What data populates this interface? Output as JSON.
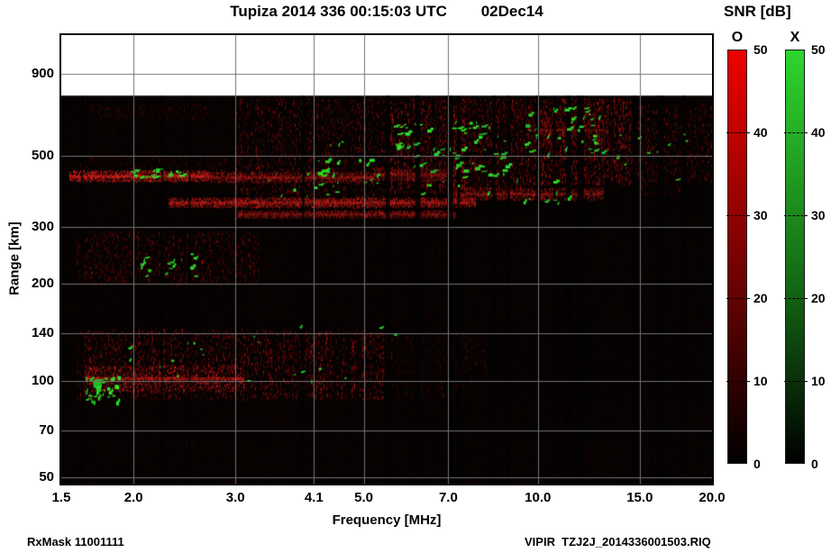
{
  "figure": {
    "footer_left": "RxMask 11001111",
    "footer_right": "VIPIR  TZJ2J_2014336001503.RIQ"
  },
  "chart_data": {
    "type": "heatmap",
    "title": "Tupiza 2014 336 00:15:03 UTC        02Dec14",
    "xlabel": "Frequency [MHz]",
    "ylabel": "Range [km]",
    "x_scale": "log",
    "y_scale": "log",
    "x_range": [
      1.5,
      20.0
    ],
    "y_range": [
      47.8,
      1188
    ],
    "x_ticks": [
      1.5,
      2.0,
      3.0,
      4.1,
      5.0,
      7.0,
      10.0,
      15.0,
      20.0
    ],
    "y_ticks": [
      900,
      500,
      300,
      200,
      140,
      100,
      70,
      50
    ],
    "grid": true,
    "data_top_km": 770,
    "background_color": "#060202",
    "o_mode_color": "#cc1414",
    "x_mode_color": "#2ec42e",
    "grid_color": "#737373",
    "seed": 11,
    "colorbar": {
      "title": "SNR [dB]",
      "min": 0,
      "max": 50,
      "ticks": [
        0,
        10,
        20,
        30,
        40,
        50
      ],
      "bars": [
        {
          "label": "O",
          "top_color": "#ee0000",
          "mid_color": "#6f0202"
        },
        {
          "label": "X",
          "top_color": "#2ed52e",
          "mid_color": "#156c15"
        }
      ]
    },
    "noise_bands": [
      {
        "f0": 1.55,
        "f1": 3.2,
        "r0": 340,
        "r1": 760,
        "density": 0.05,
        "alpha": 0.14
      },
      {
        "f0": 1.68,
        "f1": 2.68,
        "r0": 655,
        "r1": 730,
        "density": 0.22,
        "alpha": 0.26
      },
      {
        "f0": 1.61,
        "f1": 2.9,
        "r0": 430,
        "r1": 505,
        "density": 0.2,
        "alpha": 0.3
      },
      {
        "f0": 3.0,
        "f1": 5.5,
        "r0": 345,
        "r1": 760,
        "density": 0.32,
        "alpha": 0.45
      },
      {
        "f0": 5.5,
        "f1": 9.4,
        "r0": 385,
        "r1": 760,
        "density": 0.5,
        "alpha": 0.58
      },
      {
        "f0": 9.4,
        "f1": 14.5,
        "r0": 410,
        "r1": 760,
        "density": 0.52,
        "alpha": 0.62
      },
      {
        "f0": 14.5,
        "f1": 20.0,
        "r0": 420,
        "r1": 730,
        "density": 0.3,
        "alpha": 0.45
      },
      {
        "f0": 14.5,
        "f1": 18.0,
        "r0": 380,
        "r1": 425,
        "density": 0.18,
        "alpha": 0.3
      },
      {
        "f0": 3.2,
        "f1": 20.0,
        "r0": 150,
        "r1": 335,
        "density": 0.05,
        "alpha": 0.11
      },
      {
        "f0": 1.6,
        "f1": 3.3,
        "r0": 200,
        "r1": 292,
        "density": 0.3,
        "alpha": 0.42
      },
      {
        "f0": 1.6,
        "f1": 5.5,
        "r0": 88,
        "r1": 145,
        "density": 0.42,
        "alpha": 0.5
      },
      {
        "f0": 5.5,
        "f1": 8.2,
        "r0": 90,
        "r1": 140,
        "density": 0.16,
        "alpha": 0.28
      },
      {
        "f0": 1.5,
        "f1": 20.0,
        "r0": 48,
        "r1": 86,
        "density": 0.05,
        "alpha": 0.13
      }
    ],
    "traces": [
      {
        "f0": 1.55,
        "f1": 2.7,
        "r0": 418,
        "r1": 452,
        "alpha": 0.95
      },
      {
        "f0": 2.7,
        "f1": 5.2,
        "r0": 415,
        "r1": 448,
        "alpha": 0.5
      },
      {
        "f0": 5.2,
        "f1": 7.2,
        "r0": 420,
        "r1": 462,
        "alpha": 0.45
      },
      {
        "f0": 2.3,
        "f1": 7.8,
        "r0": 348,
        "r1": 372,
        "alpha": 0.7
      },
      {
        "f0": 3.0,
        "f1": 7.2,
        "r0": 322,
        "r1": 340,
        "alpha": 0.42
      },
      {
        "f0": 7.0,
        "f1": 13.0,
        "r0": 365,
        "r1": 400,
        "alpha": 0.55
      },
      {
        "f0": 9.6,
        "f1": 13.2,
        "r0": 530,
        "r1": 690,
        "alpha": 0.4
      },
      {
        "f0": 1.65,
        "f1": 3.1,
        "r0": 93,
        "r1": 112,
        "alpha": 0.8
      }
    ],
    "green_clusters": [
      {
        "f0": 1.95,
        "f1": 2.4,
        "r0": 430,
        "r1": 458,
        "n": 22,
        "w": 6,
        "h": 2
      },
      {
        "f0": 2.05,
        "f1": 2.6,
        "r0": 208,
        "r1": 250,
        "n": 18,
        "w": 4,
        "h": 3
      },
      {
        "f0": 3.4,
        "f1": 5.3,
        "r0": 375,
        "r1": 490,
        "n": 28,
        "w": 5,
        "h": 3
      },
      {
        "f0": 5.6,
        "f1": 8.8,
        "r0": 380,
        "r1": 640,
        "n": 72,
        "w": 5,
        "h": 3
      },
      {
        "f0": 9.3,
        "f1": 12.9,
        "r0": 500,
        "r1": 710,
        "n": 40,
        "w": 5,
        "h": 3
      },
      {
        "f0": 8.8,
        "f1": 11.6,
        "r0": 350,
        "r1": 425,
        "n": 10,
        "w": 4,
        "h": 3
      },
      {
        "f0": 1.65,
        "f1": 1.88,
        "r0": 86,
        "r1": 104,
        "n": 42,
        "w": 4,
        "h": 4
      },
      {
        "f0": 1.9,
        "f1": 2.7,
        "r0": 102,
        "r1": 132,
        "n": 10,
        "w": 3,
        "h": 2
      },
      {
        "f0": 13.4,
        "f1": 18.4,
        "r0": 420,
        "r1": 590,
        "n": 10,
        "w": 4,
        "h": 2
      },
      {
        "f0": 2.9,
        "f1": 4.8,
        "r0": 96,
        "r1": 150,
        "n": 9,
        "w": 3,
        "h": 2
      },
      {
        "f0": 5.3,
        "f1": 5.7,
        "r0": 138,
        "r1": 152,
        "n": 2,
        "w": 3,
        "h": 2
      },
      {
        "f0": 4.3,
        "f1": 4.6,
        "r0": 540,
        "r1": 560,
        "n": 3,
        "w": 4,
        "h": 2
      }
    ],
    "rfi_stripes": [
      {
        "f": 1.63,
        "w": 2
      },
      {
        "f": 2.24,
        "w": 2
      },
      {
        "f": 2.5,
        "w": 2
      },
      {
        "f": 3.93,
        "w": 3
      },
      {
        "f": 5.5,
        "w": 5
      },
      {
        "f": 6.2,
        "w": 6
      },
      {
        "f": 7.05,
        "w": 7
      },
      {
        "f": 7.3,
        "w": 3
      },
      {
        "f": 8.4,
        "w": 4
      },
      {
        "f": 8.9,
        "w": 3
      },
      {
        "f": 10.0,
        "w": 5
      },
      {
        "f": 10.7,
        "w": 3
      },
      {
        "f": 11.3,
        "w": 6
      },
      {
        "f": 11.85,
        "w": 8
      },
      {
        "f": 14.7,
        "w": 5
      },
      {
        "f": 16.3,
        "w": 7
      },
      {
        "f": 17.9,
        "w": 4
      }
    ]
  }
}
